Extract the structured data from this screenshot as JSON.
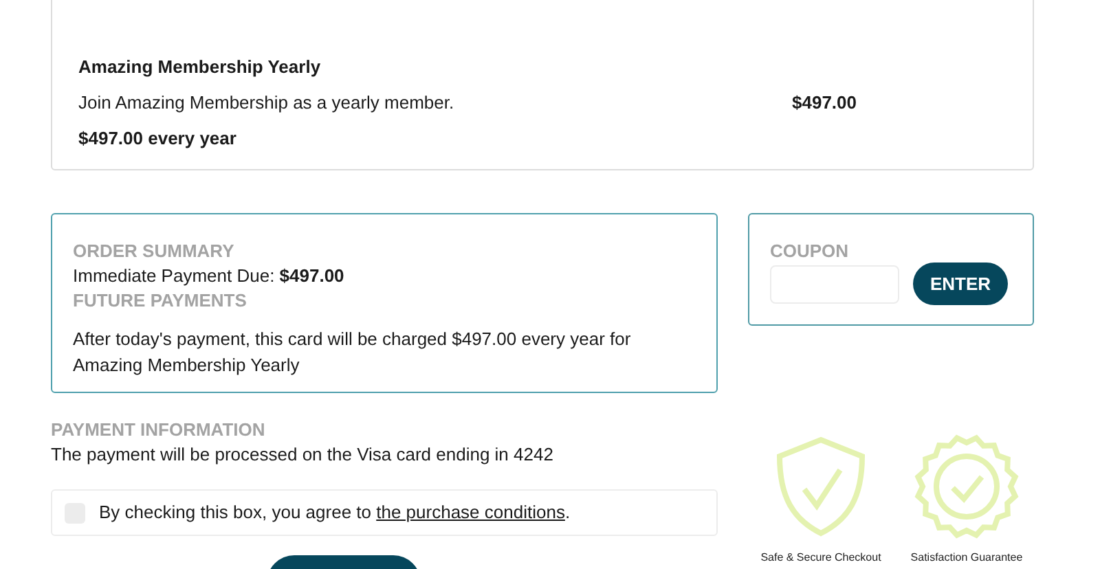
{
  "product": {
    "title": "Amazing Membership Yearly",
    "description": "Join Amazing Membership as a yearly member.",
    "price": "$497.00",
    "recurring": "$497.00 every year"
  },
  "order_summary": {
    "heading": "ORDER SUMMARY",
    "due_label": "Immediate Payment Due:",
    "due_amount": "$497.00",
    "future_heading": "FUTURE PAYMENTS",
    "future_text": "After today's payment, this card will be charged $497.00 every year for Amazing Membership Yearly"
  },
  "coupon": {
    "heading": "COUPON",
    "button": "ENTER"
  },
  "payment": {
    "heading": "PAYMENT INFORMATION",
    "text": "The payment will be processed on the Visa card ending in 4242"
  },
  "agreement": {
    "checked": false,
    "text": "By checking this box, you agree to",
    "link": "the purchase conditions",
    "after": "."
  },
  "badges": [
    {
      "kind": "shield",
      "label": "Safe & Secure Checkout"
    },
    {
      "kind": "seal",
      "label": "Satisfaction Guarantee"
    }
  ]
}
